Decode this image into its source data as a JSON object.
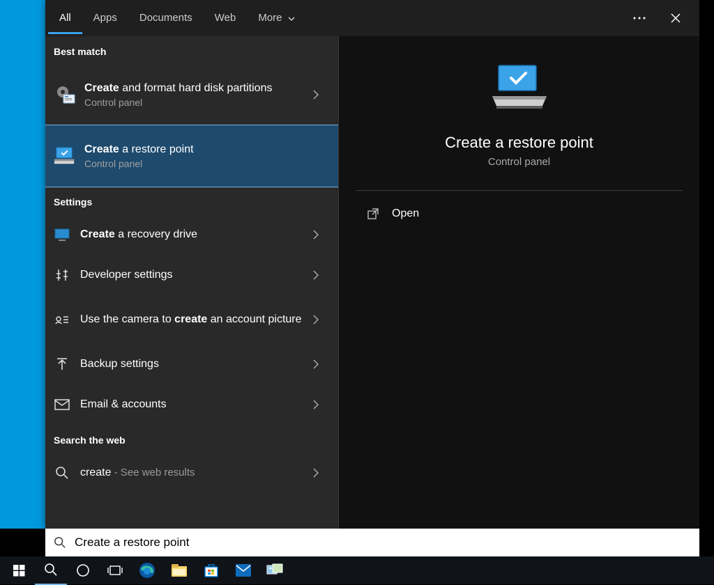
{
  "tabs": {
    "all": "All",
    "apps": "Apps",
    "documents": "Documents",
    "web": "Web",
    "more": "More"
  },
  "sections": {
    "best_match": "Best match",
    "settings": "Settings",
    "search_web": "Search the web"
  },
  "results": {
    "best_match": [
      {
        "title_html": "<b>Create</b> and format hard disk partitions",
        "subtitle": "Control panel"
      },
      {
        "title_html": "<b>Create</b> a restore point",
        "subtitle": "Control panel"
      }
    ],
    "settings": [
      {
        "title_html": "<b>Create</b> a recovery drive"
      },
      {
        "title_html": "Developer settings"
      },
      {
        "title_html": "Use the camera to <b>create</b> an account picture"
      },
      {
        "title_html": "Backup settings"
      },
      {
        "title_html": "Email & accounts"
      }
    ],
    "web": {
      "query": "create",
      "suffix": " - See web results"
    }
  },
  "preview": {
    "title": "Create a restore point",
    "subtitle": "Control panel",
    "action": "Open"
  },
  "search": {
    "value": "Create a restore point"
  }
}
